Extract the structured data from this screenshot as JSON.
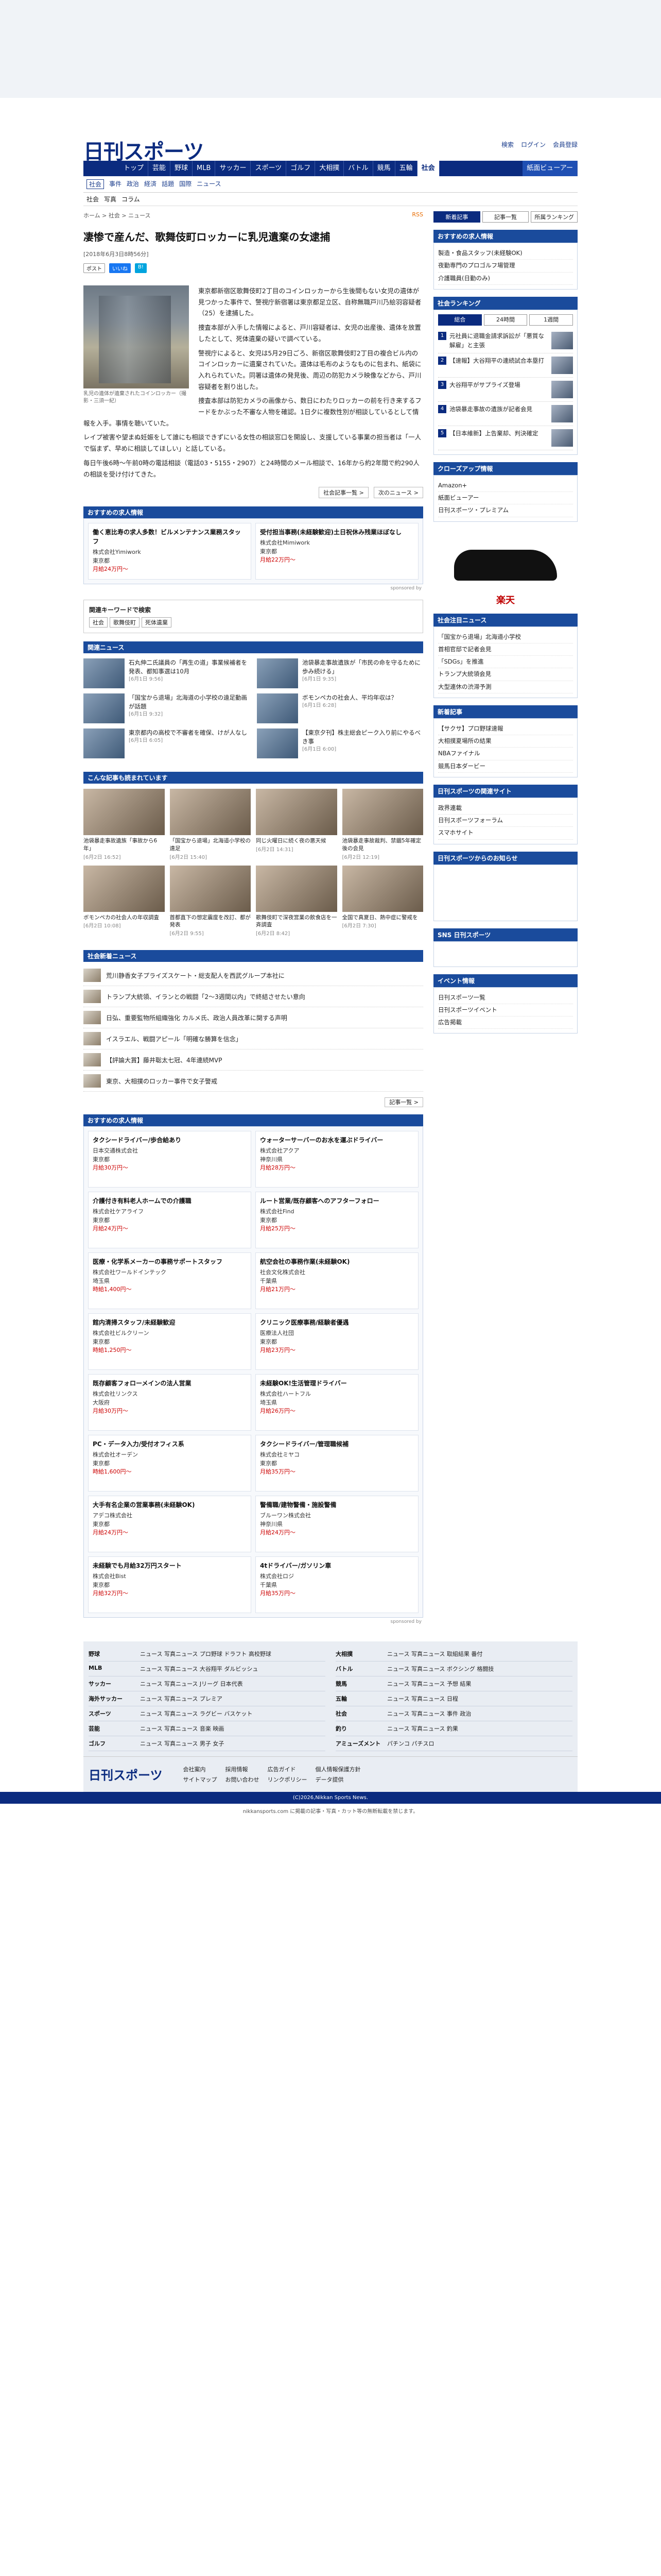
{
  "header": {
    "logo": "日刊スポーツ",
    "search": "検索",
    "login": "ログイン",
    "register": "会員登録"
  },
  "nav": [
    "トップ",
    "芸能",
    "野球",
    "MLB",
    "サッカー",
    "スポーツ",
    "ゴルフ",
    "大相撲",
    "バトル",
    "競馬",
    "五輪",
    "社会",
    "紙面ビューアー"
  ],
  "nav_active": "社会",
  "subnav": [
    "社会",
    "事件",
    "政治",
    "経済",
    "話題",
    "国際",
    "ニュース"
  ],
  "subnav2": [
    "社会",
    "写真",
    "コラム"
  ],
  "breadcrumb": "ホーム > 社会 > ニュース",
  "rss": "RSS",
  "article": {
    "title": "凄惨で産んだ、歌舞伎町ロッカーに乳児遺棄の女逮捕",
    "date": "[2018年6月3日8時56分]",
    "share": [
      "ポスト",
      "いいね",
      "B!"
    ],
    "caption": "乳児の遺体が遺棄されたコインロッカー（撮影・三須一紀）",
    "paras": [
      "東京都新宿区歌舞伎町2丁目のコインロッカーから生後間もない女児の遺体が見つかった事件で、警視庁新宿署は東京都足立区、自称無職戸川乃絵羽容疑者（25）を逮捕した。",
      "捜査本部が入手した情報によると、戸川容疑者は、女児の出産後、遺体を放置したとして、死体遺棄の疑いで調べている。",
      "警視庁によると、女児は5月29日ごろ、新宿区歌舞伎町2丁目の複合ビル内のコインロッカーに遺棄されていた。遺体は毛布のようなものに包まれ、紙袋に入れられていた。同署は遺体の発見後、周辺の防犯カメラ映像などから、戸川容疑者を割り出した。",
      "捜査本部は防犯カメラの画像から、数日にわたりロッカーの前を行き来するフードをかぶった不審な人物を確認。1日夕に複数性別が相談しているとして情報を入手。事情を聴いていた。",
      "レイプ被害や望まぬ妊娠をして誰にも相談できずにいる女性の相談窓口を開設し、支援している事業の担当者は「一人で悩まず、早めに相談してほしい」と話している。",
      "毎日午後6時〜午前0時の電話相談（電話03・5155・2907）と24時間のメール相談で、16年から約2年間で約290人の相談を受け付けてきた。"
    ],
    "prev": "社会記事一覧 >",
    "next": "次のニュース >"
  },
  "jobs_top": [
    {
      "title": "働く恵比寿の求人多数！ビルメンテナンス業務スタッフ",
      "company": "株式会社Yimiwork",
      "loc": "東京都",
      "pay": "月給24万円〜"
    },
    {
      "title": "受付担当事務(未経験歓迎)土日祝休み残業ほぼなし",
      "company": "株式会社Mimiwork",
      "loc": "東京都",
      "pay": "月給22万円〜"
    }
  ],
  "search": {
    "label": "関連キーワードで検索",
    "tags": [
      "社会",
      "歌舞伎町",
      "死体遺棄"
    ]
  },
  "related": [
    {
      "t": "石丸伸二氏議員の「再生の道」事業候補者を発表、都知事選は10月",
      "d": "[6月1日 9:56]"
    },
    {
      "t": "池袋暴走事故遺族が「市民の命を守るために歩み続ける」",
      "d": "[6月1日 9:35]"
    },
    {
      "t": "「国宝から退場」北海道の小学校の遠足動画が話題",
      "d": "[6月1日 9:32]"
    },
    {
      "t": "ボモンペカの社会人、平均年収は？",
      "d": "[6月1日 6:28]"
    },
    {
      "t": "東京都内の高校で不審者を確保、けが人なし",
      "d": "[6月1日 6:05]"
    },
    {
      "t": "【東京夕刊】株主総会ピーク入り前にやるべき事",
      "d": "[6月1日 6:00]"
    }
  ],
  "recommend": [
    {
      "t": "池袋暴走事故遺族「事故から6年」",
      "d": "[6月2日 16:52]"
    },
    {
      "t": "「国宝から退場」北海道小学校の遠足",
      "d": "[6月2日 15:40]"
    },
    {
      "t": "同じ火曜日に続く夜の悪天候",
      "d": "[6月2日 14:31]"
    },
    {
      "t": "池袋暴走事故裁判、禁錮5年確定後の会見",
      "d": "[6月2日 12:19]"
    },
    {
      "t": "ボモンペカの社会人の年収調査",
      "d": "[6月2日 10:08]"
    },
    {
      "t": "首都直下の想定震度を改訂、都が発表",
      "d": "[6月2日 9:55]"
    },
    {
      "t": "歌舞伎町で深夜営業の飲食店を一斉調査",
      "d": "[6月2日 8:42]"
    },
    {
      "t": "全国で真夏日、熱中症に警戒を",
      "d": "[6月2日 7:30]"
    }
  ],
  "social_news": [
    "荒川静香女子プライズスケート・総支配人を西武グループ本社に",
    "トランプ大統領、イランとの戦闘「2〜3週間以内」で終結させたい意向",
    "日弘、重要監物所組織強化 カルメ氏、政治人員改革に関する声明",
    "イスラエル、戦闘アピール「明確な勝算を信念」",
    "【評論大賞】藤井聡太七冠、4年連続MVP",
    "東京、大相撲のロッカー事件で女子警戒"
  ],
  "jobs_list": [
    {
      "t": "タクシードライバー/歩合給あり",
      "co": "日本交通株式会社",
      "loc": "東京都",
      "pay": "月給30万円〜"
    },
    {
      "t": "ウォーターサーバーのお水を運ぶドライバー",
      "co": "株式会社アクア",
      "loc": "神奈川県",
      "pay": "月給28万円〜"
    },
    {
      "t": "介護付き有料老人ホームでの介護職",
      "co": "株式会社ケアライフ",
      "loc": "東京都",
      "pay": "月給24万円〜"
    },
    {
      "t": "ルート営業/既存顧客へのアフターフォロー",
      "co": "株式会社Find",
      "loc": "東京都",
      "pay": "月給25万円〜"
    },
    {
      "t": "医療・化学系メーカーの事務サポートスタッフ",
      "co": "株式会社ワールドインテック",
      "loc": "埼玉県",
      "pay": "時給1,400円〜"
    },
    {
      "t": "航空会社の事務作業(未経験OK)",
      "co": "社会文化株式会社",
      "loc": "千葉県",
      "pay": "月給21万円〜"
    },
    {
      "t": "館内清掃スタッフ/未経験歓迎",
      "co": "株式会社ビルクリーン",
      "loc": "東京都",
      "pay": "時給1,250円〜"
    },
    {
      "t": "クリニック医療事務/経験者優遇",
      "co": "医療法人社団",
      "loc": "東京都",
      "pay": "月給23万円〜"
    },
    {
      "t": "既存顧客フォローメインの法人営業",
      "co": "株式会社リンクス",
      "loc": "大阪府",
      "pay": "月給30万円〜"
    },
    {
      "t": "未経験OK!生活管理ドライバー",
      "co": "株式会社ハートフル",
      "loc": "埼玉県",
      "pay": "月給26万円〜"
    },
    {
      "t": "PC・データ入力/受付オフィス系",
      "co": "株式会社オーデン",
      "loc": "東京都",
      "pay": "時給1,600円〜"
    },
    {
      "t": "タクシードライバー/管理職候補",
      "co": "株式会社ミヤコ",
      "loc": "東京都",
      "pay": "月給35万円〜"
    },
    {
      "t": "大手有名企業の営業事務(未経験OK)",
      "co": "アデコ株式会社",
      "loc": "東京都",
      "pay": "月給24万円〜"
    },
    {
      "t": "警備職/建物警備・施設警備",
      "co": "ブルーワン株式会社",
      "loc": "神奈川県",
      "pay": "月給24万円〜"
    },
    {
      "t": "未経験でも月給32万円スタート",
      "co": "株式会社Bist",
      "loc": "東京都",
      "pay": "月給32万円〜"
    },
    {
      "t": "4tドライバー/ガソリン車",
      "co": "株式会社ロジ",
      "loc": "千葉県",
      "pay": "月給35万円〜"
    }
  ],
  "side": {
    "tabs": [
      "新着記事",
      "記事一覧",
      "所属ランキング"
    ],
    "jobs_title": "おすすめの求人情報",
    "side_jobs": [
      "製造・食品スタッフ(未経験OK)",
      "夜勤専門のプロゴルフ場管理",
      "介護職員(日勤のみ)"
    ],
    "ranking_title": "社会ランキング",
    "ranking_tabs": [
      "総合",
      "24時間",
      "1週間"
    ],
    "ranking": [
      "元社員に退職金請求訴訟が「悪質な解雇」と主張",
      "【速報】大谷翔平の連続試合本塁打",
      "大谷翔平がサプライズ登場",
      "池袋暴走事故の遺族が記者会見",
      "【日本維新】上告棄却、判決確定"
    ],
    "closeup_title": "クローズアップ情報",
    "closeup": [
      "Amazon+",
      "紙面ビューアー",
      "日刊スポーツ・プレミアム"
    ],
    "shoe": "楽天",
    "social_title": "社会注目ニュース",
    "social_side": [
      "「国宝から退場」北海道小学校",
      "首相官邸で記者会見",
      "「SDGs」を推進",
      "トランプ大統領会見",
      "大型連休の渋滞予測"
    ],
    "new_title": "新着記事",
    "new_items": [
      "【サクサ】プロ野球速報",
      "大相撲夏場所の結果",
      "NBAファイナル",
      "競馬日本ダービー"
    ],
    "sites_title": "日刊スポーツの関連サイト",
    "links": [
      "政界連載",
      "日刊スポーツフォーラム",
      "スマホサイト"
    ],
    "nikkan_title": "日刊スポーツからのお知らせ",
    "sns_title": "SNS 日刊スポーツ",
    "event_title": "イベント情報",
    "events": [
      "日刊スポーツ一覧",
      "日刊スポーツイベント",
      "広告掲載"
    ]
  },
  "categories": [
    {
      "k": "野球",
      "v": "ニュース 写真ニュース プロ野球 ドラフト 高校野球"
    },
    {
      "k": "大相撲",
      "v": "ニュース 写真ニュース 取組結果 番付"
    },
    {
      "k": "MLB",
      "v": "ニュース 写真ニュース 大谷翔平 ダルビッシュ"
    },
    {
      "k": "バトル",
      "v": "ニュース 写真ニュース ボクシング 格闘技"
    },
    {
      "k": "サッカー",
      "v": "ニュース 写真ニュース Jリーグ 日本代表"
    },
    {
      "k": "競馬",
      "v": "ニュース 写真ニュース 予想 結果"
    },
    {
      "k": "海外サッカー",
      "v": "ニュース 写真ニュース プレミア"
    },
    {
      "k": "五輪",
      "v": "ニュース 写真ニュース 日程"
    },
    {
      "k": "スポーツ",
      "v": "ニュース 写真ニュース ラグビー バスケット"
    },
    {
      "k": "社会",
      "v": "ニュース 写真ニュース 事件 政治"
    },
    {
      "k": "芸能",
      "v": "ニュース 写真ニュース 音楽 映画"
    },
    {
      "k": "釣り",
      "v": "ニュース 写真ニュース 釣果"
    },
    {
      "k": "ゴルフ",
      "v": "ニュース 写真ニュース 男子 女子"
    },
    {
      "k": "アミューズメント",
      "v": "パチンコ パチスロ"
    }
  ],
  "footer": {
    "logo": "日刊スポーツ",
    "links": [
      "会社案内",
      "採用情報",
      "広告ガイド",
      "個人情報保護方針",
      "サイトマップ",
      "お問い合わせ",
      "リンクポリシー",
      "データ提供"
    ],
    "copyright": "(C)2026,Nikkan Sports News.",
    "notice": "nikkansports.com に掲載の記事・写真・カット等の無断転載を禁じます。"
  }
}
